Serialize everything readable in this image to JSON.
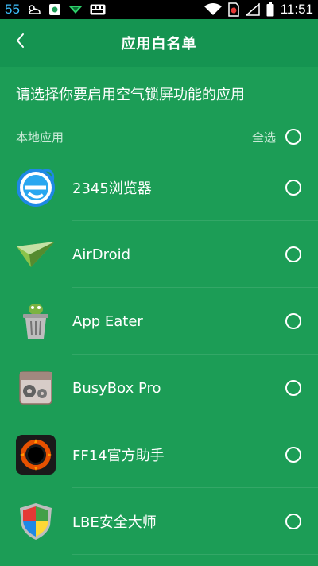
{
  "status_bar": {
    "left_number": "55",
    "time": "11:51",
    "icons": [
      "weather-cloud-icon",
      "app-notification-icon",
      "download-icon",
      "keyboard-icon",
      "wifi-icon",
      "sim-blocked-icon",
      "signal-icon",
      "battery-icon"
    ]
  },
  "header": {
    "title": "应用白名单",
    "back_icon": "chevron-left-icon"
  },
  "subtitle": "请选择你要启用空气锁屏功能的应用",
  "section": {
    "label": "本地应用",
    "select_all": "全选"
  },
  "apps": [
    {
      "name": "2345浏览器",
      "icon": "browser-e-icon",
      "selected": false
    },
    {
      "name": "AirDroid",
      "icon": "paper-plane-icon",
      "selected": false
    },
    {
      "name": "App Eater",
      "icon": "trash-bin-icon",
      "selected": false
    },
    {
      "name": "BusyBox Pro",
      "icon": "gears-box-icon",
      "selected": false
    },
    {
      "name": "FF14官方助手",
      "icon": "dark-ring-icon",
      "selected": false
    },
    {
      "name": "LBE安全大师",
      "icon": "shield-icon",
      "selected": false
    }
  ],
  "colors": {
    "background": "#1c9d56",
    "app_bar": "#159451",
    "status_bar": "#000000"
  }
}
